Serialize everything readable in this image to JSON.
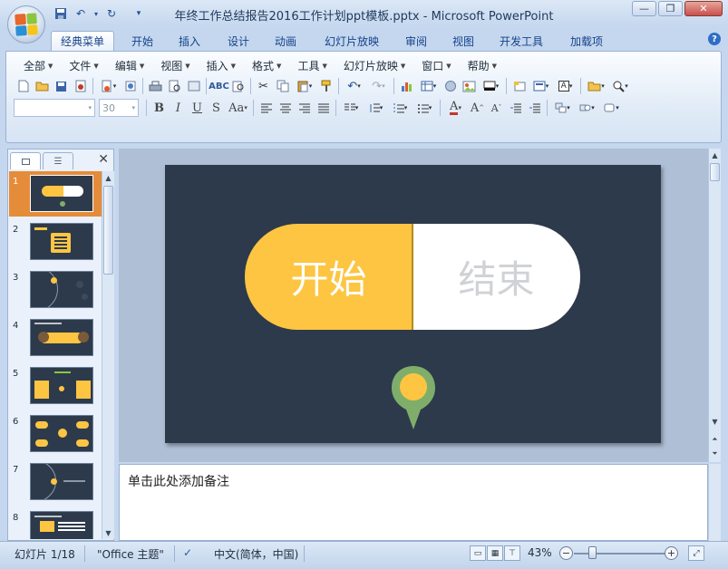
{
  "app": {
    "window_title": "年终工作总结报告2016工作计划ppt模板.pptx - Microsoft PowerPoint"
  },
  "ribbon_tabs": [
    "经典菜单",
    "开始",
    "插入",
    "设计",
    "动画",
    "幻灯片放映",
    "审阅",
    "视图",
    "开发工具",
    "加载项"
  ],
  "active_tab": "经典菜单",
  "classic_menu": [
    "全部",
    "文件",
    "编辑",
    "视图",
    "插入",
    "格式",
    "工具",
    "幻灯片放映",
    "窗口",
    "帮助"
  ],
  "font": {
    "name_value": "",
    "size_value": "30"
  },
  "icons": {
    "qat": [
      "save-icon",
      "undo-icon",
      "redo-icon",
      "customize-icon"
    ],
    "toolbar1": [
      "new-icon",
      "open-icon",
      "save-icon",
      "permission-icon",
      "print-preview-icon",
      "publish-icon",
      "print-icon",
      "preview-icon",
      "spelling-icon",
      "research-icon",
      "cut-icon",
      "copy-icon",
      "paste-icon",
      "format-painter-icon",
      "undo-icon",
      "redo-icon",
      "chart-icon",
      "table-icon",
      "hyperlink-icon",
      "picture-icon",
      "color-icon",
      "new-slide-icon",
      "layout-icon",
      "text-box-icon",
      "folder-icon",
      "zoom-icon"
    ],
    "toolbar2": [
      "bold-icon",
      "italic-icon",
      "underline-icon",
      "shadow-icon",
      "change-case-icon",
      "align-left-icon",
      "align-center-icon",
      "align-right-icon",
      "justify-icon",
      "columns-icon",
      "line-spacing-icon",
      "numbering-icon",
      "bullets-icon",
      "font-color-icon",
      "grow-font-icon",
      "shrink-font-icon",
      "decrease-indent-icon",
      "increase-indent-icon",
      "arrange-icon",
      "shapes-icon",
      "quick-styles-icon"
    ]
  },
  "panes": {
    "slides_tab_icon": "slides-tab-icon",
    "outline_tab_icon": "outline-tab-icon",
    "close_label": "✕"
  },
  "thumbnails": [
    {
      "num": "1",
      "selected": true
    },
    {
      "num": "2",
      "selected": false
    },
    {
      "num": "3",
      "selected": false
    },
    {
      "num": "4",
      "selected": false
    },
    {
      "num": "5",
      "selected": false
    },
    {
      "num": "6",
      "selected": false
    },
    {
      "num": "7",
      "selected": false
    },
    {
      "num": "8",
      "selected": false
    }
  ],
  "slide": {
    "left_text": "开始",
    "right_text": "结束",
    "background": "#2d3a4b",
    "accent": "#fdc542",
    "pin_color": "#7fae6b"
  },
  "notes": {
    "placeholder": "单击此处添加备注"
  },
  "status": {
    "slide_info": "幻灯片 1/18",
    "theme": "\"Office 主题\"",
    "language": "中文(简体，中国)",
    "zoom": "43%"
  }
}
